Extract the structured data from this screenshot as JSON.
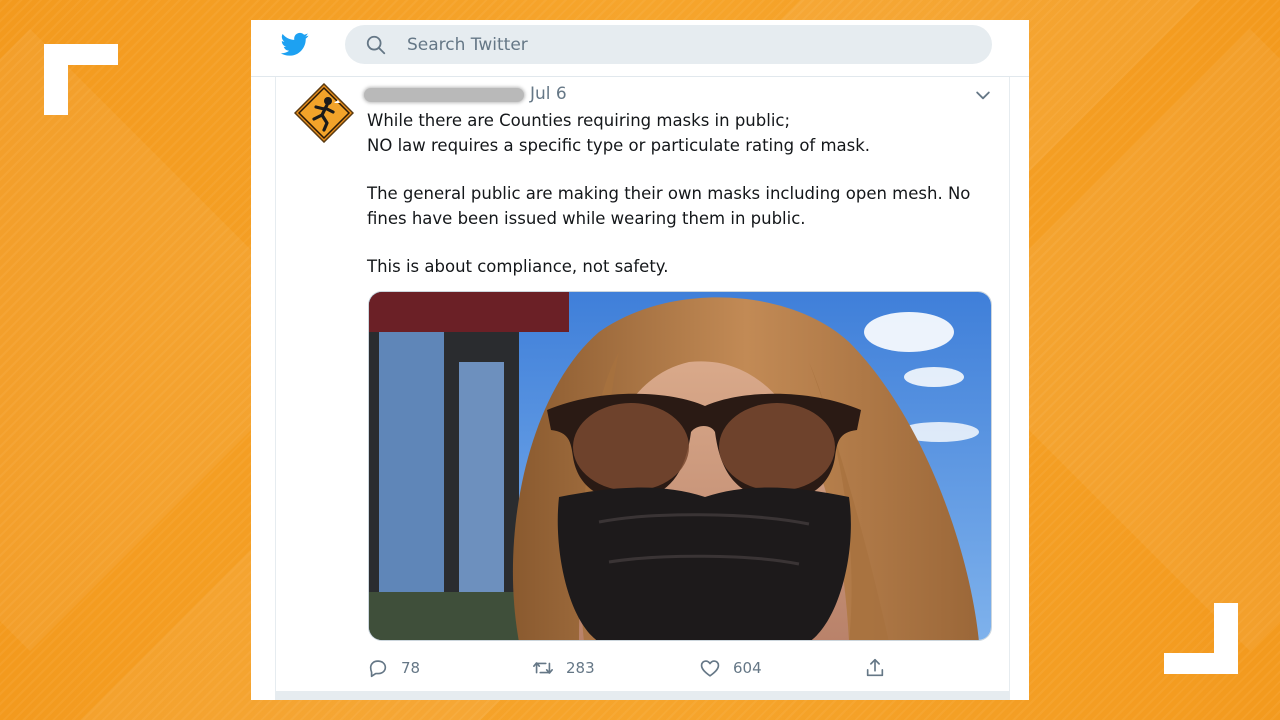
{
  "search": {
    "placeholder": "Search Twitter"
  },
  "tweet": {
    "date": "Jul 6",
    "paragraphs": [
      "While there are Counties requiring masks in public;\nNO law requires a specific type or particulate rating of mask.",
      "The general public are making their own masks including open mesh.  No fines have been issued while wearing them in public.",
      "This is about compliance, not safety."
    ],
    "stats": {
      "replies": "78",
      "retweets": "283",
      "likes": "604"
    }
  },
  "icons": {
    "logo": "twitter-bird-icon",
    "search": "search-icon",
    "caret": "chevron-down-icon",
    "reply": "reply-icon",
    "retweet": "retweet-icon",
    "like": "heart-icon",
    "share": "share-icon"
  },
  "colors": {
    "background": "#f49d22",
    "twitter_blue": "#1da1f2",
    "muted_text": "#657786",
    "search_bg": "#e6ecf0"
  }
}
